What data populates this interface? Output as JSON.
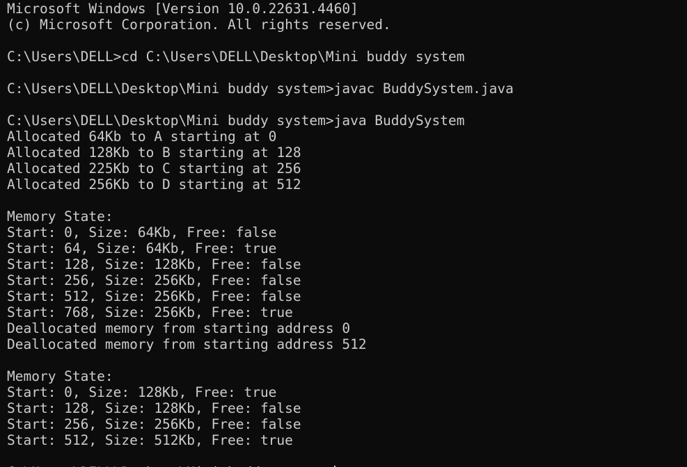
{
  "terminal": {
    "lines": [
      "Microsoft Windows [Version 10.0.22631.4460]",
      "(c) Microsoft Corporation. All rights reserved.",
      "",
      "C:\\Users\\DELL>cd C:\\Users\\DELL\\Desktop\\Mini buddy system",
      "",
      "C:\\Users\\DELL\\Desktop\\Mini buddy system>javac BuddySystem.java",
      "",
      "C:\\Users\\DELL\\Desktop\\Mini buddy system>java BuddySystem",
      "Allocated 64Kb to A starting at 0",
      "Allocated 128Kb to B starting at 128",
      "Allocated 225Kb to C starting at 256",
      "Allocated 256Kb to D starting at 512",
      "",
      "Memory State:",
      "Start: 0, Size: 64Kb, Free: false",
      "Start: 64, Size: 64Kb, Free: true",
      "Start: 128, Size: 128Kb, Free: false",
      "Start: 256, Size: 256Kb, Free: false",
      "Start: 512, Size: 256Kb, Free: false",
      "Start: 768, Size: 256Kb, Free: true",
      "Deallocated memory from starting address 0",
      "Deallocated memory from starting address 512",
      "",
      "Memory State:",
      "Start: 0, Size: 128Kb, Free: true",
      "Start: 128, Size: 128Kb, Free: false",
      "Start: 256, Size: 256Kb, Free: false",
      "Start: 512, Size: 512Kb, Free: true",
      ""
    ],
    "prompt": "C:\\Users\\DELL\\Desktop\\Mini buddy system>"
  },
  "colors": {
    "background": "#0c0c0c",
    "foreground": "#cccccc"
  }
}
